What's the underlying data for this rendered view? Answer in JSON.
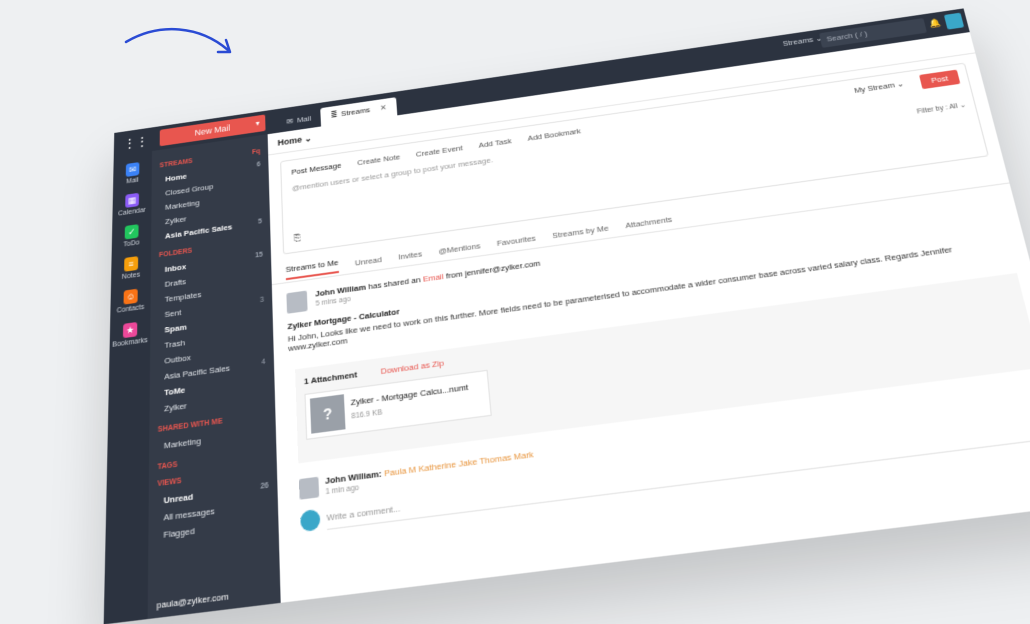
{
  "topbar": {
    "new_mail": "New Mail",
    "tabs": [
      {
        "label": "Mail"
      },
      {
        "label": "Streams"
      }
    ],
    "streams_pill": "Streams ⌄",
    "search_placeholder": "Search ( / )"
  },
  "rail": [
    {
      "label": "Mail",
      "icon": "mail-icon",
      "color": "#3b82f6"
    },
    {
      "label": "Calendar",
      "icon": "calendar-icon",
      "color": "#8b5cf6"
    },
    {
      "label": "ToDo",
      "icon": "check-icon",
      "color": "#22c55e"
    },
    {
      "label": "Notes",
      "icon": "notes-icon",
      "color": "#f59e0b"
    },
    {
      "label": "Contacts",
      "icon": "contacts-icon",
      "color": "#f97316"
    },
    {
      "label": "Bookmarks",
      "icon": "bookmark-icon",
      "color": "#ec4899"
    }
  ],
  "sidebar": {
    "streams_header": "STREAMS",
    "streams_count": "Fq",
    "streams": [
      {
        "label": "Home",
        "bold": true,
        "count": "6"
      },
      {
        "label": "Closed Group",
        "bold": false,
        "count": ""
      },
      {
        "label": "Marketing",
        "bold": false,
        "count": ""
      },
      {
        "label": "Zylker",
        "bold": false,
        "count": ""
      },
      {
        "label": "Asia Pacific Sales",
        "bold": true,
        "count": "5"
      }
    ],
    "folders_header": "FOLDERS",
    "folders": [
      {
        "label": "Inbox",
        "bold": true,
        "count": "15"
      },
      {
        "label": "Drafts",
        "bold": false,
        "count": ""
      },
      {
        "label": "Templates",
        "bold": false,
        "count": ""
      },
      {
        "label": "Sent",
        "bold": false,
        "count": "3"
      },
      {
        "label": "Spam",
        "bold": true,
        "count": ""
      },
      {
        "label": "Trash",
        "bold": false,
        "count": ""
      },
      {
        "label": "Outbox",
        "bold": false,
        "count": ""
      },
      {
        "label": "Asia Pacific Sales",
        "bold": false,
        "count": "4"
      },
      {
        "label": "ToMe",
        "bold": true,
        "count": ""
      },
      {
        "label": "Zylker",
        "bold": false,
        "count": ""
      }
    ],
    "shared_header": "SHARED WITH ME",
    "shared": [
      {
        "label": "Marketing",
        "bold": false,
        "count": ""
      }
    ],
    "tags_header": "TAGS",
    "views_header": "VIEWS",
    "views": [
      {
        "label": "Unread",
        "bold": true,
        "count": "26"
      },
      {
        "label": "All messages",
        "bold": false,
        "count": ""
      },
      {
        "label": "Flagged",
        "bold": false,
        "count": ""
      }
    ],
    "account": "paula@zylker.com"
  },
  "main": {
    "home": "Home ⌄",
    "actions": [
      "Post Message",
      "Create Note",
      "Create Event",
      "Add Task",
      "Add Bookmark"
    ],
    "my_stream": "My Stream ⌄",
    "post": "Post",
    "placeholder": "@mention users or select a group to post your message.",
    "filter": "Filter by : All ⌄",
    "feed_tabs": [
      "Streams to Me",
      "Unread",
      "Invites",
      "@Mentions",
      "Favourites",
      "Streams by Me",
      "Attachments"
    ],
    "post_item": {
      "author": "John William",
      "action_1": " has shared an ",
      "action_link": "Email",
      "action_2": " from jennifer@zylker.com",
      "time": "5 mins ago",
      "title": "Zylker Mortgage - Calculator",
      "body": "Hi John, Looks like we need to work on this further. More fields need to be parameterised to accommodate a wider consumer base across varied salary class. Regards Jennifer www.zylker.com"
    },
    "attachment": {
      "header": "1 Attachment",
      "download": "Download as Zip",
      "name": "Zylker - Mortgage Calcu...numt",
      "size": "816.9 KB"
    },
    "reply": {
      "author": "John William:",
      "names": "Paula M  Katherine Jake  Thomas Mark",
      "time": "1 min ago"
    },
    "comment_placeholder": "Write a comment..."
  }
}
